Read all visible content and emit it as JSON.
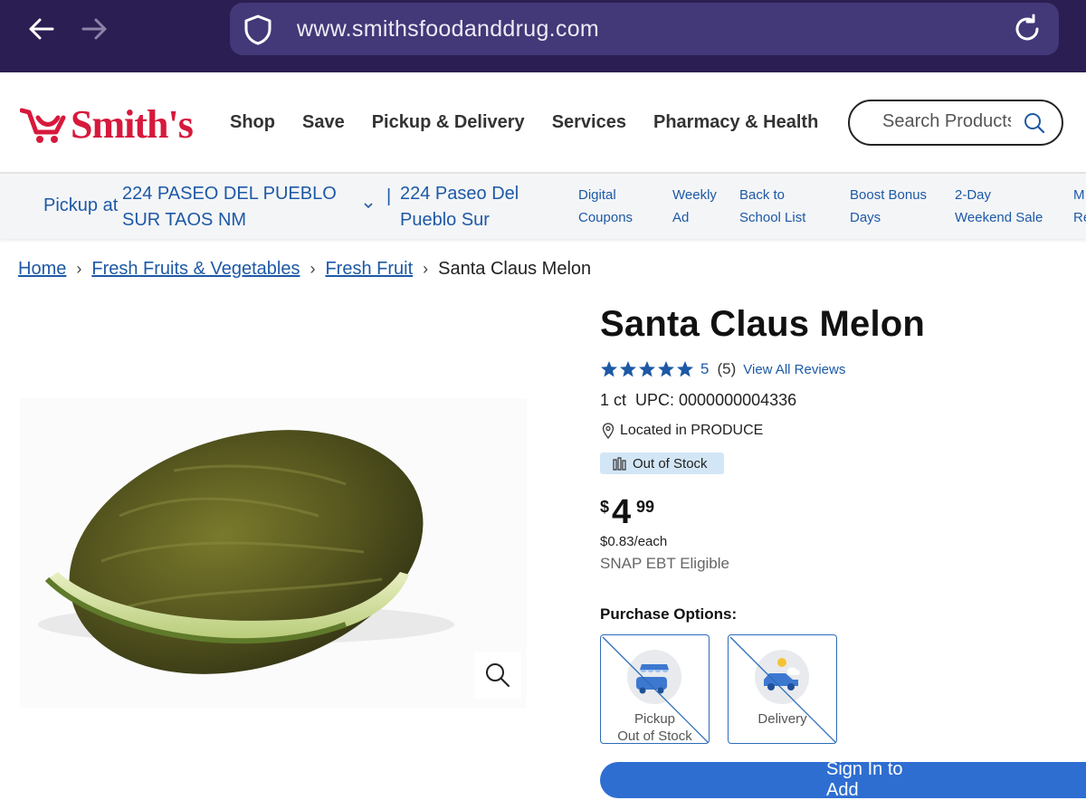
{
  "browser": {
    "url": "www.smithsfoodanddrug.com"
  },
  "header": {
    "logo_text": "Smith's",
    "nav": [
      "Shop",
      "Save",
      "Pickup & Delivery",
      "Services",
      "Pharmacy & Health"
    ],
    "search_placeholder": "Search Products"
  },
  "subnav": {
    "pickup_label": "Pickup at",
    "pickup_address": "224 PASEO DEL PUEBLO SUR TAOS NM",
    "store_name": "224 Paseo Del Pueblo Sur",
    "links": [
      {
        "line1": "Digital",
        "line2": "Coupons"
      },
      {
        "line1": "Weekly",
        "line2": "Ad"
      },
      {
        "line1": "Back to",
        "line2": "School List"
      },
      {
        "line1": "Boost Bonus",
        "line2": "Days"
      },
      {
        "line1": "2-Day",
        "line2": "Weekend Sale"
      },
      {
        "line1": "M",
        "line2": "Re"
      }
    ]
  },
  "breadcrumb": {
    "items": [
      "Home",
      "Fresh Fruits & Vegetables",
      "Fresh Fruit"
    ],
    "current": "Santa Claus Melon"
  },
  "product": {
    "title": "Santa Claus Melon",
    "rating": 5,
    "rating_value": "5",
    "rating_count": "(5)",
    "view_reviews": "View All Reviews",
    "size": "1 ct",
    "upc": "UPC: 0000000004336",
    "location": "Located in PRODUCE",
    "stock_status": "Out of Stock",
    "price_currency": "$",
    "price_dollars": "4",
    "price_cents": "99",
    "unit_price": "$0.83/each",
    "snap": "SNAP EBT Eligible",
    "purchase_title": "Purchase Options:",
    "options": [
      {
        "label": "Pickup",
        "status": "Out of Stock"
      },
      {
        "label": "Delivery"
      }
    ],
    "signin_label": "Sign In to Add"
  },
  "colors": {
    "browser_bg": "#2b1e52",
    "brand_red": "#d6193c",
    "link_blue": "#1d59a6",
    "button_blue": "#2e6ed1",
    "badge_bg": "#d3e6f6"
  }
}
